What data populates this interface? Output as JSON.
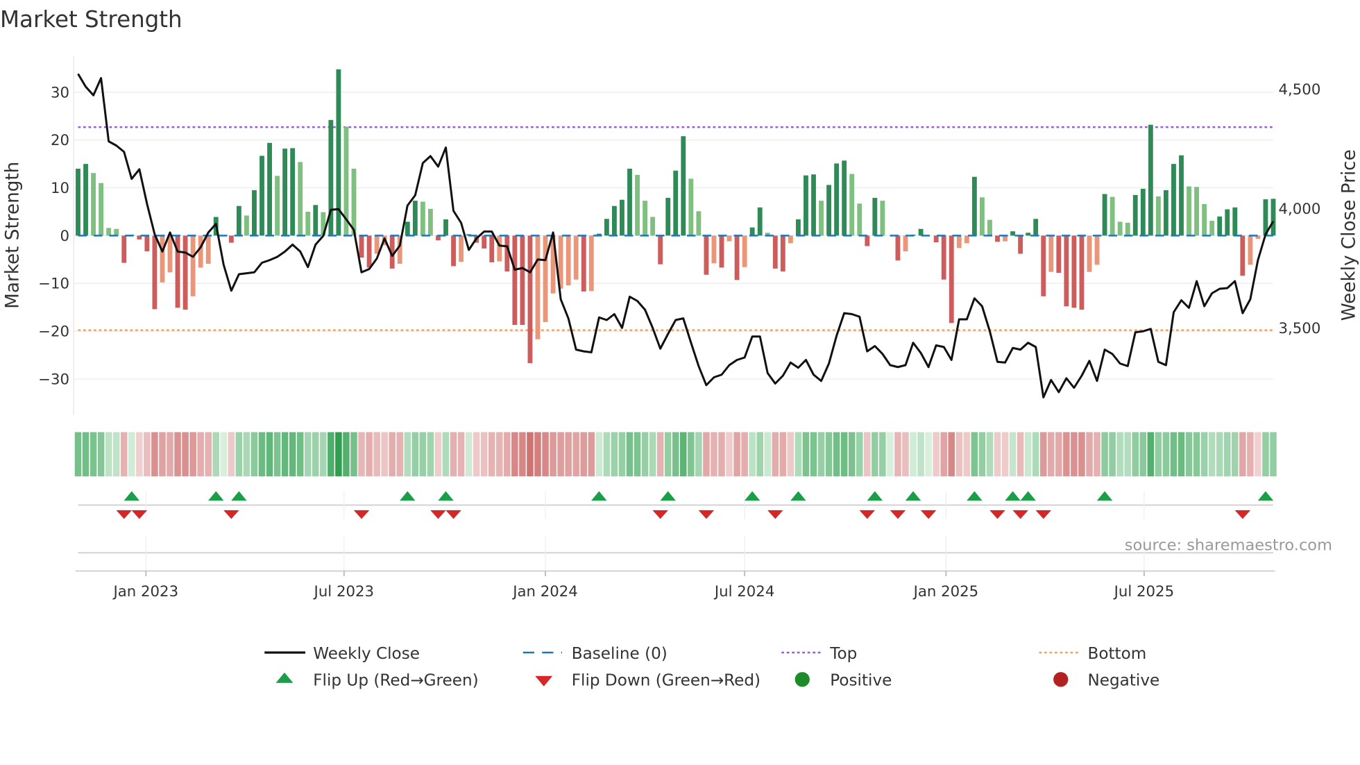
{
  "title": "Market Strength",
  "source": "source: sharemaestro.com",
  "chart_data": {
    "type": "bar",
    "title": "Market Strength",
    "frequency": "weekly",
    "start_week": "2022-10-31",
    "ylabel": "Market Strength",
    "y2label": "Weekly Close Price",
    "ylim": [
      -37.5,
      37.5
    ],
    "y2lim": [
      3136,
      4638
    ],
    "yticks": [
      30,
      20,
      10,
      0,
      -10,
      -20,
      -30
    ],
    "ytick_labels": [
      "30",
      "20",
      "10",
      "0",
      "−10",
      "−20",
      "−30"
    ],
    "y2ticks": [
      4500,
      4000,
      3500
    ],
    "y2tick_labels": [
      "4,500",
      "4,000",
      "3,500"
    ],
    "xticks": [
      {
        "date": "2023-01-01",
        "label": "Jan 2023"
      },
      {
        "date": "2023-07-01",
        "label": "Jul 2023"
      },
      {
        "date": "2024-01-01",
        "label": "Jan 2024"
      },
      {
        "date": "2024-07-01",
        "label": "Jul 2024"
      },
      {
        "date": "2025-01-01",
        "label": "Jan 2025"
      },
      {
        "date": "2025-07-01",
        "label": "Jul 2025"
      }
    ],
    "top_level": 22.7,
    "bottom_level": -19.8,
    "grid": true,
    "strength": [
      14.0,
      15.0,
      13.1,
      11.0,
      1.6,
      1.4,
      -5.7,
      0.2,
      -0.8,
      -3.3,
      -15.4,
      -9.8,
      -7.7,
      -15.1,
      -15.5,
      -12.7,
      -6.7,
      -5.9,
      3.9,
      0,
      -1.5,
      6.2,
      4.2,
      9.5,
      16.7,
      19.4,
      12.5,
      18.2,
      18.3,
      15.4,
      5.0,
      6.4,
      4.9,
      24.2,
      34.8,
      22.8,
      14.0,
      -4.6,
      -6.7,
      -3.8,
      -2.0,
      -6.9,
      -5.9,
      2.9,
      7.3,
      7.1,
      5.6,
      -1.0,
      3.4,
      -6.4,
      -5.5,
      0.3,
      -1.5,
      -2.7,
      -5.6,
      -5.4,
      -7.5,
      -18.7,
      -18.7,
      -26.7,
      -21.7,
      -18.1,
      -12.1,
      -11.1,
      -10.4,
      -9.2,
      -11.7,
      -11.6,
      0.4,
      3.5,
      6.2,
      7.5,
      14.0,
      12.7,
      7.3,
      3.9,
      -6.0,
      7.9,
      13.6,
      20.8,
      11.9,
      5.1,
      -8.2,
      -5.8,
      -6.7,
      -1.2,
      -9.3,
      -6.6,
      1.7,
      5.9,
      0.6,
      -6.9,
      -7.5,
      -1.6,
      3.4,
      12.6,
      12.8,
      7.3,
      10.6,
      15.1,
      15.7,
      12.9,
      6.7,
      -2.2,
      7.9,
      7.3,
      0,
      -5.2,
      -3.3,
      0.2,
      1.4,
      0,
      -1.4,
      -9.2,
      -18.3,
      -2.6,
      -1.6,
      12.3,
      8.0,
      3.3,
      -1.3,
      -1.2,
      0.9,
      -3.8,
      0.6,
      3.5,
      -12.7,
      -7.6,
      -7.8,
      -14.8,
      -15.1,
      -15.5,
      -7.6,
      -6.1,
      8.7,
      8.1,
      2.9,
      2.7,
      8.5,
      9.8,
      23.2,
      8.2,
      9.5,
      15.0,
      16.8,
      10.3,
      10.2,
      6.6,
      3.1,
      4.0,
      5.5,
      5.9,
      -8.4,
      -6.1,
      -0.7,
      7.6,
      7.7
    ],
    "weekly_close": [
      4565,
      4511,
      4475,
      4547,
      4282,
      4264,
      4238,
      4125,
      4165,
      4020,
      3893,
      3820,
      3900,
      3820,
      3816,
      3798,
      3838,
      3900,
      3936,
      3765,
      3656,
      3725,
      3729,
      3733,
      3773,
      3784,
      3798,
      3820,
      3849,
      3820,
      3755,
      3849,
      3886,
      3995,
      3998,
      3955,
      3911,
      3733,
      3747,
      3791,
      3875,
      3802,
      3845,
      4013,
      4056,
      4191,
      4220,
      4176,
      4256,
      3991,
      3940,
      3827,
      3875,
      3904,
      3904,
      3845,
      3842,
      3744,
      3751,
      3733,
      3787,
      3784,
      3900,
      3620,
      3540,
      3409,
      3402,
      3398,
      3544,
      3533,
      3558,
      3500,
      3631,
      3613,
      3576,
      3500,
      3413,
      3475,
      3533,
      3540,
      3438,
      3340,
      3260,
      3293,
      3304,
      3344,
      3366,
      3376,
      3464,
      3464,
      3311,
      3267,
      3300,
      3355,
      3333,
      3366,
      3304,
      3278,
      3351,
      3467,
      3562,
      3558,
      3547,
      3402,
      3424,
      3391,
      3344,
      3336,
      3344,
      3438,
      3395,
      3336,
      3427,
      3420,
      3366,
      3536,
      3536,
      3624,
      3591,
      3486,
      3358,
      3355,
      3416,
      3409,
      3438,
      3420,
      3209,
      3282,
      3231,
      3289,
      3249,
      3300,
      3362,
      3278,
      3409,
      3391,
      3351,
      3340,
      3482,
      3486,
      3496,
      3358,
      3344,
      3566,
      3616,
      3584,
      3696,
      3591,
      3645,
      3664,
      3667,
      3696,
      3562,
      3620,
      3784,
      3893,
      3947
    ],
    "flip_up_weeks": [
      7,
      18,
      21,
      43,
      48,
      68,
      77,
      88,
      94,
      104,
      109,
      117,
      122,
      124,
      134,
      155
    ],
    "flip_down_weeks": [
      6,
      8,
      20,
      37,
      47,
      49,
      76,
      82,
      91,
      103,
      107,
      111,
      120,
      123,
      126,
      152
    ],
    "legend": {
      "placement": "bottom",
      "items": [
        {
          "key": "close",
          "label": "Weekly Close"
        },
        {
          "key": "baseline",
          "label": "Baseline (0)"
        },
        {
          "key": "top",
          "label": "Top"
        },
        {
          "key": "bottom",
          "label": "Bottom"
        },
        {
          "key": "flip_up",
          "label": "Flip Up (Red→Green)"
        },
        {
          "key": "flip_down",
          "label": "Flip Down (Green→Red)"
        },
        {
          "key": "positive",
          "label": "Positive"
        },
        {
          "key": "negative",
          "label": "Negative"
        }
      ]
    },
    "colors": {
      "pos_rising": "#2e8b57",
      "pos_falling": "#7fbf7f",
      "neg_falling": "#cd5c5c",
      "neg_rising": "#e9967a",
      "close": "#111111",
      "baseline": "#1f77b4",
      "top": "#9b59d6",
      "bottom": "#f0a35e",
      "flip_up": "#1a9e48",
      "flip_down": "#d62728",
      "positive": "#1f8a2a",
      "negative": "#b22222",
      "grid": "#eceef2"
    }
  }
}
